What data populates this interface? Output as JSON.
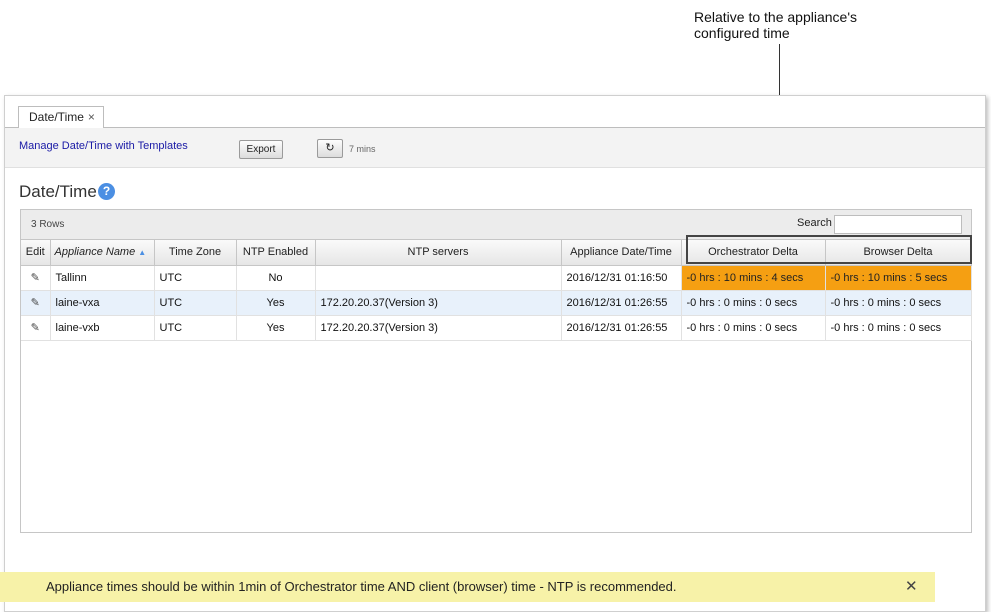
{
  "callout": {
    "text": "Relative to the appliance's configured time"
  },
  "tab": {
    "label": "Date/Time",
    "close": "×"
  },
  "toolbar": {
    "manage_link": "Manage Date/Time with Templates",
    "export_label": "Export",
    "refresh_icon": "↻",
    "refresh_age": "7 mins"
  },
  "page": {
    "title": "Date/Time",
    "help_icon": "?"
  },
  "grid": {
    "rows_count": "3 Rows",
    "search_label": "Search",
    "search_value": "",
    "columns": [
      "Edit",
      "Appliance Name",
      "Time Zone",
      "NTP Enabled",
      "NTP servers",
      "Appliance Date/Time",
      "Orchestrator Delta",
      "Browser Delta"
    ],
    "rows": [
      {
        "edit": "✎",
        "name": "Tallinn",
        "tz": "UTC",
        "ntp_enabled": "No",
        "ntp_servers": "",
        "datetime": "2016/12/31 01:16:50",
        "orch_delta": "-0 hrs : 10 mins : 4 secs",
        "browser_delta": "-0 hrs : 10 mins : 5 secs"
      },
      {
        "edit": "✎",
        "name": "laine-vxa",
        "tz": "UTC",
        "ntp_enabled": "Yes",
        "ntp_servers": "172.20.20.37(Version 3)",
        "datetime": "2016/12/31 01:26:55",
        "orch_delta": "-0 hrs : 0 mins : 0 secs",
        "browser_delta": "-0 hrs : 0 mins : 0 secs"
      },
      {
        "edit": "✎",
        "name": "laine-vxb",
        "tz": "UTC",
        "ntp_enabled": "Yes",
        "ntp_servers": "172.20.20.37(Version 3)",
        "datetime": "2016/12/31 01:26:55",
        "orch_delta": "-0 hrs : 0 mins : 0 secs",
        "browser_delta": "-0 hrs : 0 mins : 0 secs"
      }
    ]
  },
  "banner": {
    "message": "Appliance times should be within 1min of Orchestrator time AND client (browser) time - NTP is recommended.",
    "close": "✕"
  },
  "colors": {
    "warning": "#f59f12",
    "link": "#1a1aa6",
    "accent": "#4b8fe3",
    "banner": "#f7f2a8"
  }
}
